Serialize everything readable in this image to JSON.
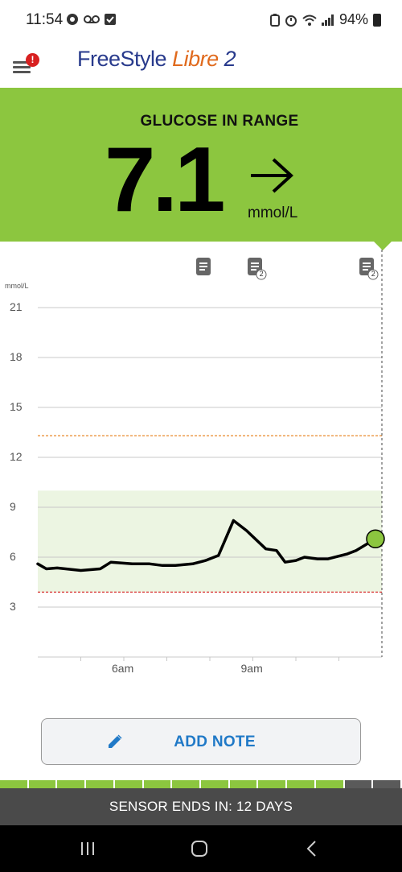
{
  "status_bar": {
    "time": "11:54",
    "battery": "94%",
    "left_icons": [
      "whatsapp-icon",
      "voicemail-icon",
      "check-box-icon"
    ],
    "right_icons": [
      "battery-saver-icon",
      "alarm-icon",
      "wifi-icon",
      "signal-icon",
      "battery-icon"
    ]
  },
  "app_bar": {
    "brand_part1": "FreeStyle",
    "brand_part2": "Libre",
    "brand_part3": "2",
    "alert_badge": "!"
  },
  "glucose": {
    "title": "GLUCOSE IN RANGE",
    "value": "7.1",
    "unit": "mmol/L",
    "trend": "steady-right-arrow",
    "banner_color": "#8cc63f"
  },
  "chart_data": {
    "type": "line",
    "ylabel": "mmol/L",
    "y_ticks": [
      "21",
      "18",
      "15",
      "12",
      "9",
      "6",
      "3"
    ],
    "x_ticks": [
      "6am",
      "9am"
    ],
    "ylim": [
      0,
      21
    ],
    "x_start_hour": 4,
    "x_end_hour": 12,
    "target_range": [
      3.9,
      10.0
    ],
    "high_threshold": 13.3,
    "low_threshold": 3.9,
    "series": [
      {
        "values": [
          [
            4.0,
            5.6
          ],
          [
            4.2,
            5.3
          ],
          [
            4.45,
            5.35
          ],
          [
            5.0,
            5.2
          ],
          [
            5.45,
            5.3
          ],
          [
            5.7,
            5.7
          ],
          [
            6.2,
            5.6
          ],
          [
            6.6,
            5.6
          ],
          [
            6.9,
            5.5
          ],
          [
            7.2,
            5.5
          ],
          [
            7.6,
            5.6
          ],
          [
            7.9,
            5.8
          ],
          [
            8.2,
            6.1
          ],
          [
            8.55,
            8.2
          ],
          [
            8.85,
            7.6
          ],
          [
            9.3,
            6.5
          ],
          [
            9.55,
            6.4
          ],
          [
            9.75,
            5.7
          ],
          [
            10.0,
            5.8
          ],
          [
            10.2,
            6.0
          ],
          [
            10.5,
            5.9
          ],
          [
            10.75,
            5.9
          ],
          [
            11.2,
            6.2
          ],
          [
            11.4,
            6.4
          ],
          [
            11.85,
            7.1
          ]
        ]
      }
    ],
    "current_point": [
      11.85,
      7.1
    ],
    "note_markers": [
      {
        "hour": 7.85,
        "count": ""
      },
      {
        "hour": 9.05,
        "count": "2"
      },
      {
        "hour": 11.65,
        "count": "2"
      }
    ],
    "grid": true
  },
  "actions": {
    "add_note_label": "ADD NOTE"
  },
  "sensor": {
    "ends_text": "SENSOR ENDS IN: 12 DAYS",
    "days_remaining": 12,
    "days_total": 14,
    "active_color": "#8cc63f",
    "inactive_color": "#5a5a5a"
  },
  "nav": {
    "buttons": [
      "recent-apps-icon",
      "home-icon",
      "back-icon"
    ]
  }
}
